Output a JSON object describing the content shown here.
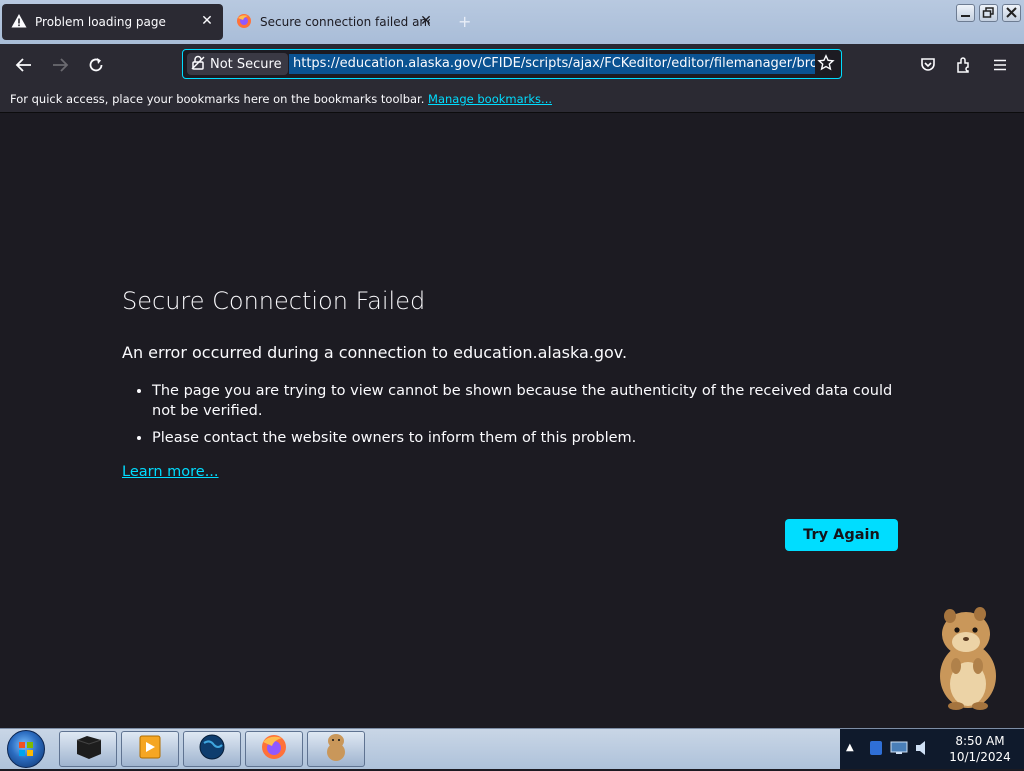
{
  "tabs": [
    {
      "title": "Problem loading page",
      "icon": "warning-icon",
      "active": true
    },
    {
      "title": "Secure connection failed and Fi",
      "icon": "firefox-icon",
      "active": false
    }
  ],
  "toolbar": {
    "security_label": "Not Secure",
    "url": "https://education.alaska.gov/CFIDE/scripts/ajax/FCKeditor/editor/filemanager/browser/"
  },
  "bookmarks": {
    "hint": "For quick access, place your bookmarks here on the bookmarks toolbar.",
    "manage_link": "Manage bookmarks..."
  },
  "error": {
    "title": "Secure Connection Failed",
    "description": "An error occurred during a connection to education.alaska.gov.",
    "bullets": [
      "The page you are trying to view cannot be shown because the authenticity of the received data could not be verified.",
      "Please contact the website owners to inform them of this problem."
    ],
    "learn_more": "Learn more...",
    "try_again": "Try Again"
  },
  "taskbar": {
    "items": [
      "terminal-icon",
      "media-player-icon",
      "globe-icon",
      "firefox-icon",
      "hamster-app-icon"
    ],
    "clock_time": "8:50 AM",
    "clock_date": "10/1/2024"
  },
  "colors": {
    "accent": "#00ddff",
    "page_bg": "#1c1b22",
    "toolbar_bg": "#2b2a33"
  }
}
